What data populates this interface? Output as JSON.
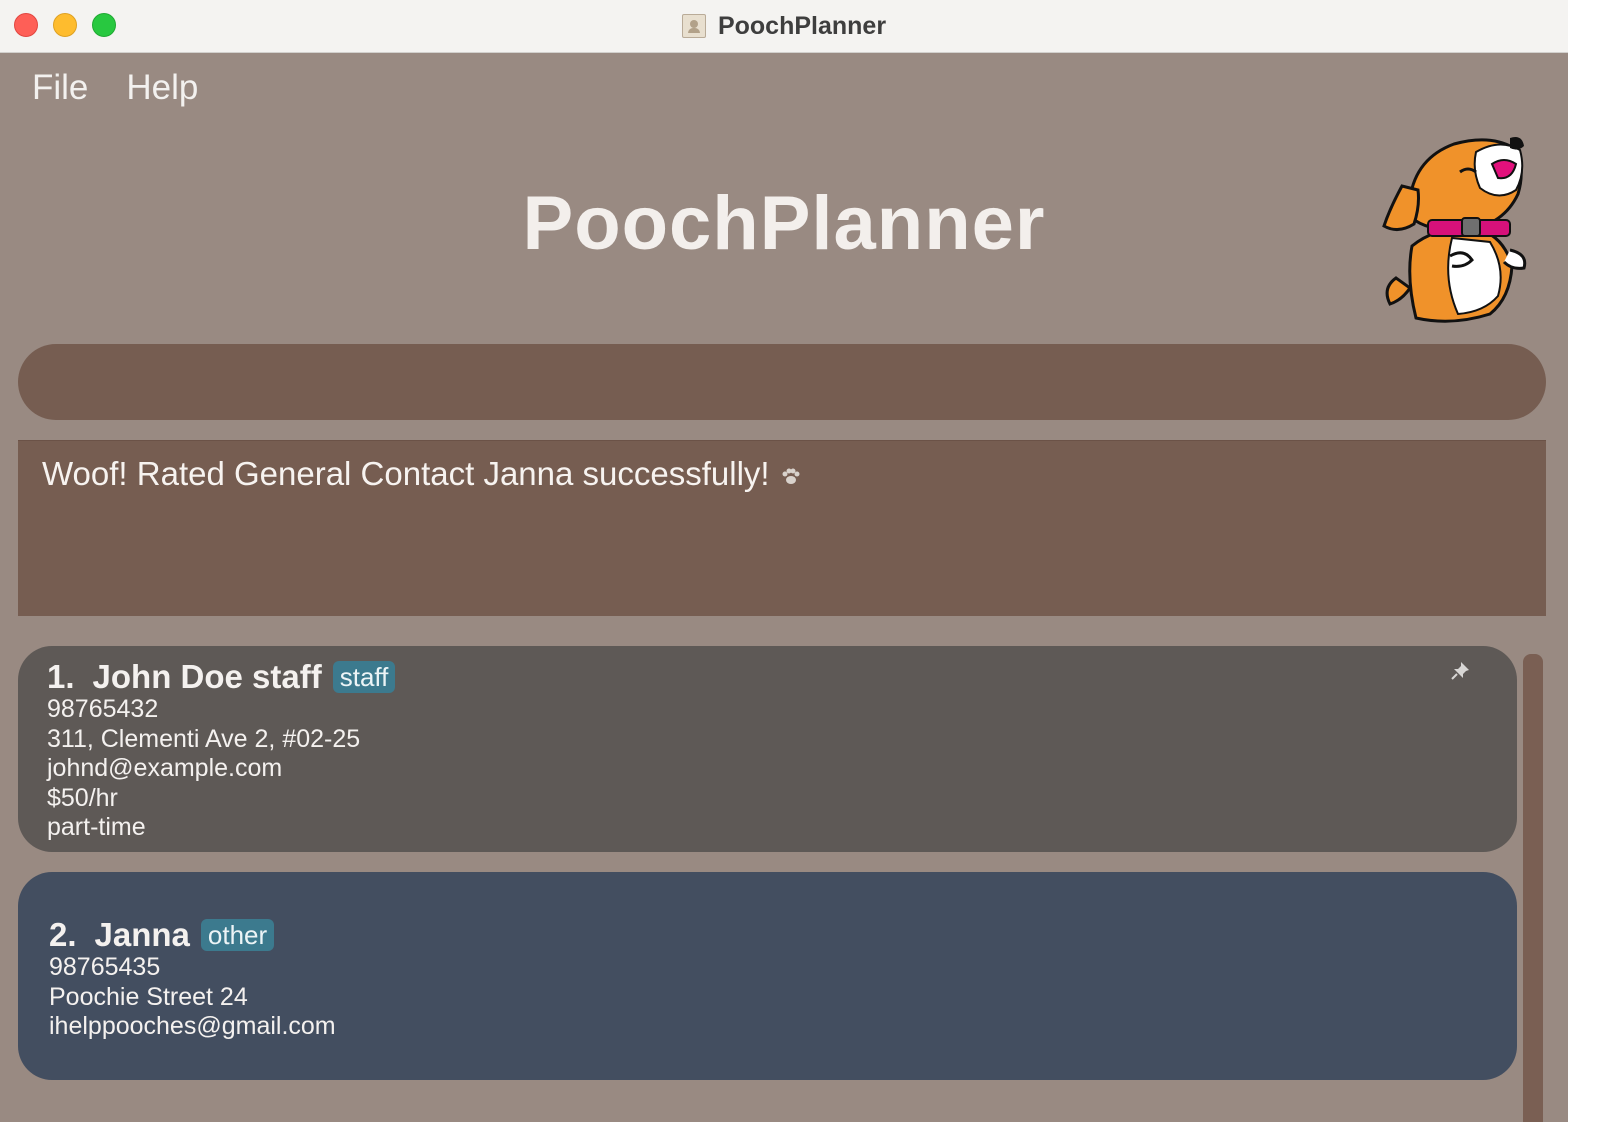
{
  "window": {
    "title": "PoochPlanner"
  },
  "menu": {
    "items": [
      {
        "label": "File"
      },
      {
        "label": "Help"
      }
    ]
  },
  "header": {
    "app_title": "PoochPlanner",
    "mascot": "dog-mascot-icon"
  },
  "command_box": {
    "value": ""
  },
  "result": {
    "message": "Woof! Rated General Contact Janna successfully!",
    "icon": "paw-icon"
  },
  "contacts": [
    {
      "index": "1.",
      "name": "John Doe staff",
      "tag": "staff",
      "phone": "98765432",
      "address": "311, Clementi Ave 2, #02-25",
      "email": "johnd@example.com",
      "salary": "$50/hr",
      "employment": "part-time",
      "pinned": true
    },
    {
      "index": "2.",
      "name": "Janna",
      "tag": "other",
      "phone": "98765435",
      "address": "Poochie Street 24",
      "email": "ihelppooches@gmail.com"
    }
  ],
  "colors": {
    "background": "#998a82",
    "command_box": "#765d51",
    "card_staff": "#5e5956",
    "card_other": "#434e60",
    "tag": "#3c7a8e"
  }
}
